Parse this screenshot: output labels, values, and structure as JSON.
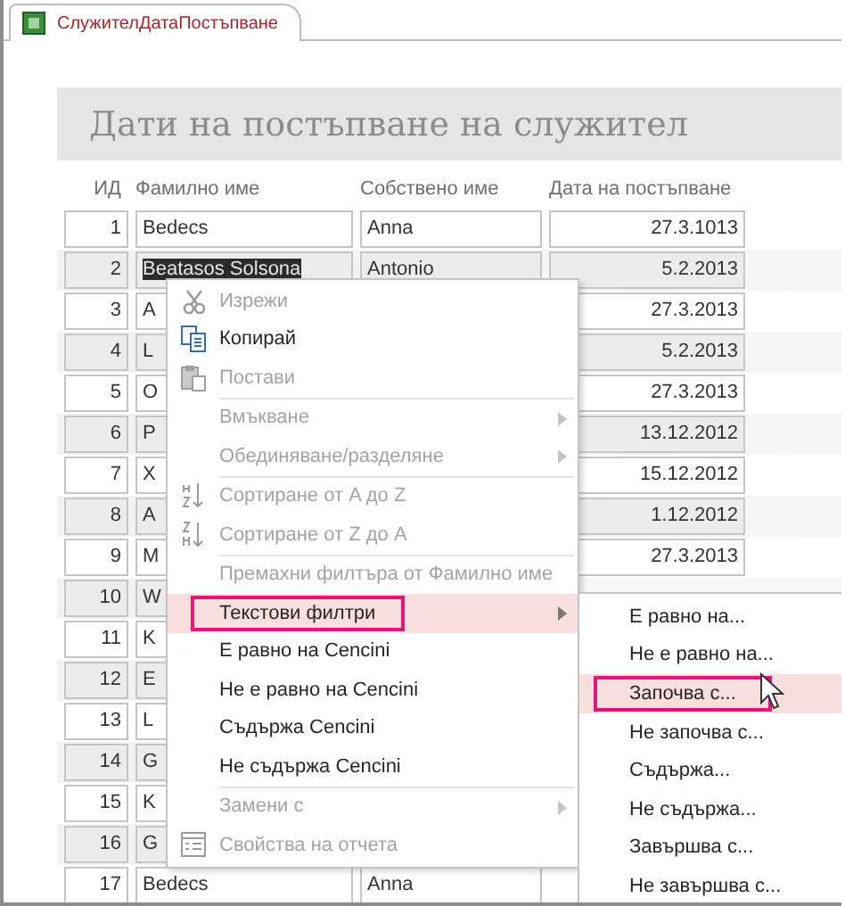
{
  "tab": {
    "title": "СлужителДатаПостъпване",
    "selected": true
  },
  "report_title": "Дати на постъпване на служител",
  "columns": [
    "ИД",
    "Фамилно име",
    "Собствено име",
    "Дата на постъпване"
  ],
  "rows": [
    {
      "id": "1",
      "last_name": "Bedecs",
      "first_name": "Anna",
      "date": "27.3.1013",
      "selected": false
    },
    {
      "id": "2",
      "last_name": "Beatasos Solsona",
      "first_name": "Antonio",
      "date": "5.2.2013",
      "selected": true
    },
    {
      "id": "3",
      "last_name": "A",
      "date": "27.3.2013",
      "selected": false
    },
    {
      "id": "4",
      "last_name": "L",
      "date": "5.2.2013",
      "selected": false
    },
    {
      "id": "5",
      "last_name": "O",
      "date": "27.3.2013",
      "selected": false
    },
    {
      "id": "6",
      "last_name": "P",
      "date": "13.12.2012",
      "selected": false
    },
    {
      "id": "7",
      "last_name": "X",
      "date": "15.12.2012",
      "selected": false
    },
    {
      "id": "8",
      "last_name": "A",
      "date": "1.12.2012",
      "selected": false
    },
    {
      "id": "9",
      "last_name": "M",
      "date": "27.3.2013",
      "selected": false
    },
    {
      "id": "10",
      "last_name": "W",
      "selected": false
    },
    {
      "id": "11",
      "last_name": "K",
      "selected": false
    },
    {
      "id": "12",
      "last_name": "E",
      "selected": false
    },
    {
      "id": "13",
      "last_name": "L",
      "selected": false
    },
    {
      "id": "14",
      "last_name": "G",
      "selected": false
    },
    {
      "id": "15",
      "last_name": "K",
      "selected": false
    },
    {
      "id": "16",
      "last_name": "G",
      "selected": false
    },
    {
      "id": "17",
      "last_name": "Bedecs",
      "first_name": "Anna",
      "selected": false
    }
  ],
  "context_menu": [
    {
      "kind": "cut",
      "label": "Изрежи",
      "disabled": true,
      "submenu": false,
      "selected": false
    },
    {
      "kind": "copy",
      "label": "Копирай",
      "disabled": false,
      "submenu": false,
      "selected": false
    },
    {
      "kind": "paste",
      "label": "Постави",
      "disabled": true,
      "submenu": false,
      "selected": false
    },
    {
      "kind": "separator"
    },
    {
      "kind": "plain",
      "label": "Вмъкване",
      "disabled": true,
      "submenu": true,
      "selected": false
    },
    {
      "kind": "plain",
      "label": "Обединяване/разделяне",
      "disabled": true,
      "submenu": true,
      "selected": false
    },
    {
      "kind": "separator"
    },
    {
      "kind": "sort-asc",
      "label": "Сортиране от A до Z",
      "disabled": true,
      "submenu": false,
      "selected": false
    },
    {
      "kind": "sort-desc",
      "label": "Сортиране от Z до A",
      "disabled": true,
      "submenu": false,
      "selected": false
    },
    {
      "kind": "separator"
    },
    {
      "kind": "plain",
      "label": "Премахни филтъра от Фамилно име",
      "disabled": true,
      "submenu": false,
      "selected": false
    },
    {
      "kind": "plain",
      "label": "Текстови филтри",
      "disabled": false,
      "submenu": true,
      "selected": true
    },
    {
      "kind": "plain",
      "label": "Е равно на Cencini",
      "disabled": false,
      "submenu": false,
      "selected": false
    },
    {
      "kind": "plain",
      "label": "Не е равно на Cencini",
      "disabled": false,
      "submenu": false,
      "selected": false
    },
    {
      "kind": "plain",
      "label": "Съдържа Cencini",
      "disabled": false,
      "submenu": false,
      "selected": false
    },
    {
      "kind": "plain",
      "label": "Не съдържа Cencini",
      "disabled": false,
      "submenu": false,
      "selected": false
    },
    {
      "kind": "separator"
    },
    {
      "kind": "plain",
      "label": "Замени с",
      "disabled": true,
      "submenu": true,
      "selected": false
    },
    {
      "kind": "properties",
      "label": "Свойства на отчета",
      "disabled": true,
      "submenu": false,
      "selected": false
    }
  ],
  "submenu": [
    {
      "label": "Е равно на...",
      "selected": false
    },
    {
      "label": "Не е равно на...",
      "selected": false
    },
    {
      "label": "Започва с...",
      "selected": true
    },
    {
      "label": "Не започва с...",
      "selected": false
    },
    {
      "label": "Съдържа...",
      "selected": false
    },
    {
      "label": "Не съдържа...",
      "selected": false
    },
    {
      "label": "Завършва с...",
      "selected": false
    },
    {
      "label": "Не завършва с...",
      "selected": false
    }
  ]
}
